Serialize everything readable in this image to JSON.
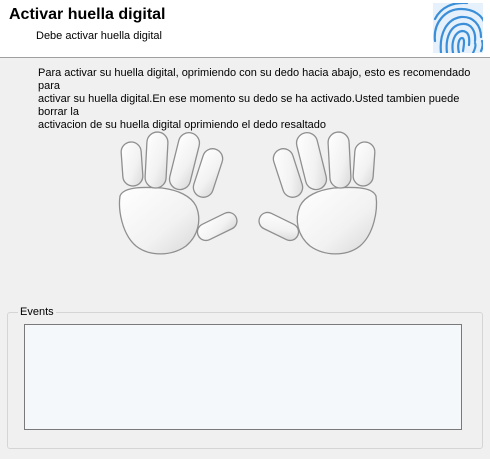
{
  "header": {
    "title": "Activar huella digital",
    "subtitle": "Debe activar huella digital",
    "icon": "fingerprint-icon",
    "icon_color": "#3b8fd8"
  },
  "instructions": "Para activar su huella digital, oprimiendo con su dedo hacia abajo, esto es recomendado para\nactivar su huella digital.En ese momento su dedo se ha activado.Usted tambien puede borrar la\nactivacion de su huella digital oprimiendo el dedo resaltado",
  "events": {
    "legend": "Events",
    "content": ""
  }
}
